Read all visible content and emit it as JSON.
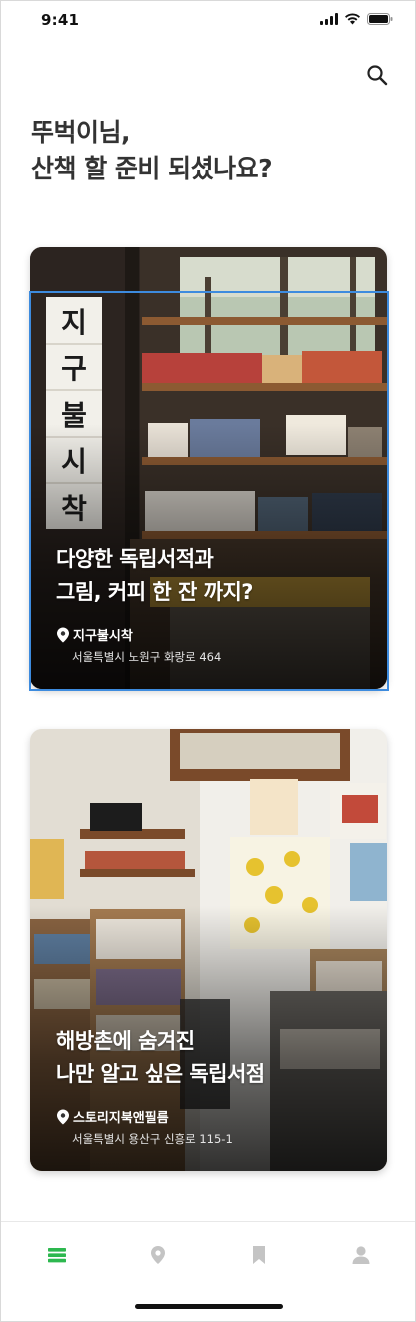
{
  "status_bar": {
    "time": "9:41"
  },
  "header": {
    "greeting_line1": "뚜벅이님,",
    "greeting_line2": "산책 할 준비 되셨나요?"
  },
  "cards": [
    {
      "title_line1": "다양한 독립서적과",
      "title_line2": "그림, 커피 한 잔 까지?",
      "place_name": "지구불시착",
      "address": "서울특별시 노원구 화랑로 464",
      "sign_letters": "지구불시착"
    },
    {
      "title_line1": "해방촌에 숨겨진",
      "title_line2": "나만 알고 싶은 독립서점",
      "place_name": "스토리지북앤필름",
      "address": "서울특별시 용산구 신흥로 115-1"
    }
  ],
  "tab_bar": {
    "active_color": "#2db84f",
    "inactive_color": "#c4c4c4",
    "tabs": [
      "list-icon",
      "map-pin-icon",
      "bookmark-icon",
      "profile-icon"
    ]
  }
}
